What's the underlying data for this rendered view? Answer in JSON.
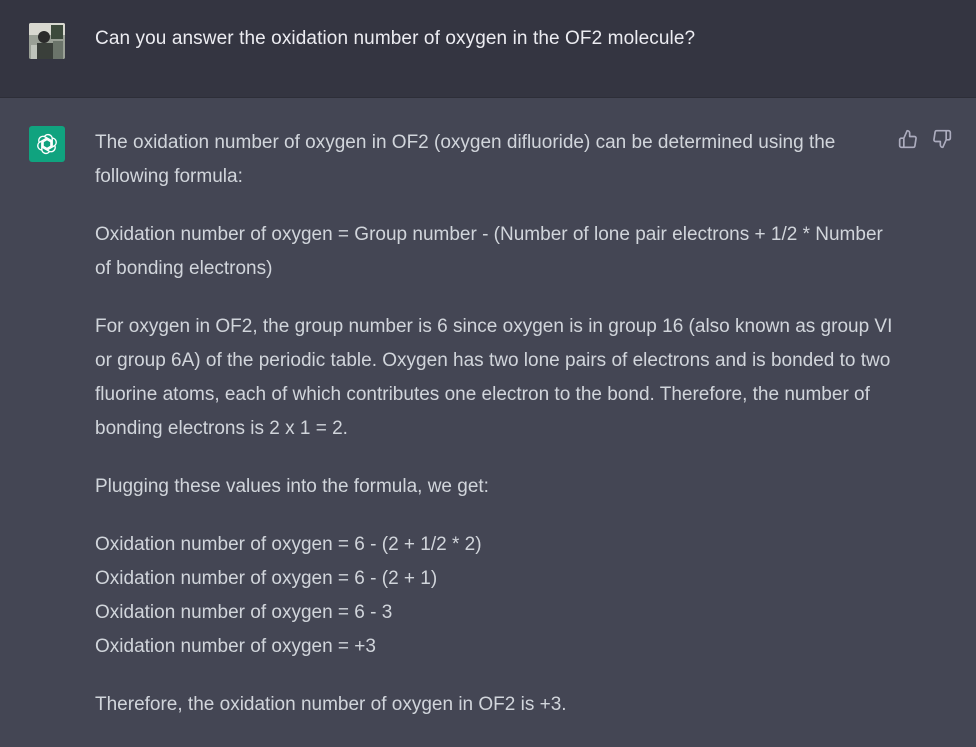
{
  "user": {
    "message": "Can you answer the oxidation number of oxygen in the OF2 molecule?"
  },
  "assistant": {
    "paragraphs": [
      "The oxidation number of oxygen in OF2 (oxygen difluoride) can be determined using the following formula:",
      "Oxidation number of oxygen = Group number - (Number of lone pair electrons + 1/2 * Number of bonding electrons)",
      "For oxygen in OF2, the group number is 6 since oxygen is in group 16 (also known as group VI or group 6A) of the periodic table. Oxygen has two lone pairs of electrons and is bonded to two fluorine atoms, each of which contributes one electron to the bond. Therefore, the number of bonding electrons is 2 x 1 = 2.",
      "Plugging these values into the formula, we get:"
    ],
    "equations": [
      "Oxidation number of oxygen = 6 - (2 + 1/2 * 2)",
      "Oxidation number of oxygen = 6 - (2 + 1)",
      "Oxidation number of oxygen = 6 - 3",
      "Oxidation number of oxygen = +3"
    ],
    "conclusion": "Therefore, the oxidation number of oxygen in OF2 is +3."
  },
  "icons": {
    "user_avatar": "user-avatar",
    "assistant_logo": "openai-logo-icon",
    "thumbs_up": "thumbs-up-icon",
    "thumbs_down": "thumbs-down-icon"
  },
  "colors": {
    "user_bg": "#343541",
    "assistant_bg": "#444654",
    "logo_bg": "#10a37f",
    "text": "#d1d5db"
  }
}
